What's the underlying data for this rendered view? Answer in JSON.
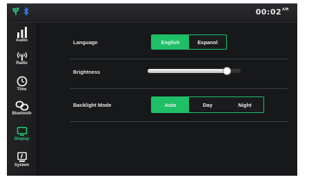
{
  "status_bar": {
    "icons": [
      "usb-icon",
      "bluetooth-icon"
    ],
    "time": "00:02",
    "ampm": "AM"
  },
  "sidebar": {
    "items": [
      {
        "label": "Audio",
        "icon": "audio-bars-icon",
        "active": false
      },
      {
        "label": "Radio",
        "icon": "radio-antenna-icon",
        "active": false
      },
      {
        "label": "Time",
        "icon": "clock-icon",
        "active": false
      },
      {
        "label": "Bluetooth",
        "icon": "bluetooth-link-icon",
        "active": false
      },
      {
        "label": "Display",
        "icon": "display-icon",
        "active": true
      },
      {
        "label": "System",
        "icon": "system-icon",
        "active": false
      }
    ]
  },
  "settings": {
    "language": {
      "label": "Language",
      "options": [
        "English",
        "Espanol"
      ],
      "selected": "English"
    },
    "brightness": {
      "label": "Brightness",
      "level": 0.85
    },
    "backlight": {
      "label": "Backlight Mode",
      "options": [
        "Auto",
        "Day",
        "Night"
      ],
      "selected": "Auto"
    }
  },
  "colors": {
    "accent": "#1fbf66",
    "background": "#17181a",
    "text": "#e8e8e8"
  }
}
